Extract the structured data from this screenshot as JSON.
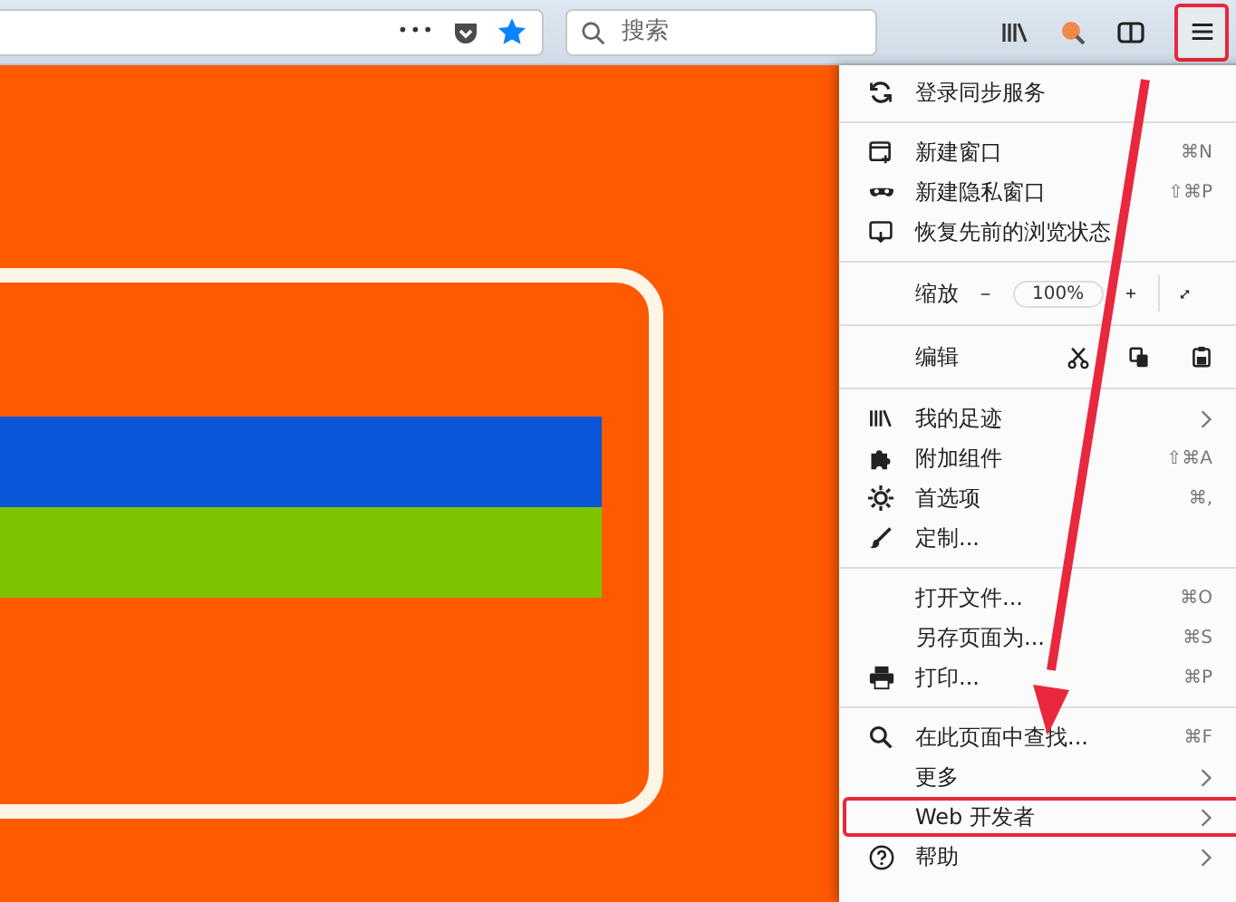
{
  "toolbar": {
    "page_actions": "•••",
    "search": {
      "placeholder": "搜索"
    },
    "menu_button": {
      "highlighted": true
    }
  },
  "menu": {
    "sections": [
      {
        "items": [
          {
            "kind": "item",
            "label": "登录同步服务",
            "submenu": false,
            "highlighted": false
          }
        ]
      },
      {
        "items": [
          {
            "kind": "item",
            "label": "新建窗口",
            "shortcut": "⌘N",
            "submenu": false,
            "highlighted": false
          },
          {
            "kind": "item",
            "label": "新建隐私窗口",
            "shortcut": "⇧⌘P",
            "submenu": false,
            "highlighted": false
          },
          {
            "kind": "item",
            "label": "恢复先前的浏览状态",
            "submenu": false,
            "highlighted": false
          }
        ]
      },
      {
        "items": [
          {
            "kind": "zoom",
            "label": "缩放",
            "value": "100%"
          }
        ]
      },
      {
        "items": [
          {
            "kind": "edit",
            "label": "编辑"
          }
        ]
      },
      {
        "items": [
          {
            "kind": "item",
            "label": "我的足迹",
            "submenu": true,
            "highlighted": false
          },
          {
            "kind": "item",
            "label": "附加组件",
            "shortcut": "⇧⌘A",
            "submenu": false,
            "highlighted": false
          },
          {
            "kind": "item",
            "label": "首选项",
            "shortcut": "⌘,",
            "submenu": false,
            "highlighted": false
          },
          {
            "kind": "item",
            "label": "定制...",
            "submenu": false,
            "highlighted": false
          }
        ]
      },
      {
        "items": [
          {
            "kind": "item",
            "label": "打开文件...",
            "shortcut": "⌘O",
            "submenu": false,
            "highlighted": false
          },
          {
            "kind": "item",
            "label": "另存页面为...",
            "shortcut": "⌘S",
            "submenu": false,
            "highlighted": false
          },
          {
            "kind": "item",
            "label": "打印...",
            "shortcut": "⌘P",
            "submenu": false,
            "highlighted": false
          }
        ]
      },
      {
        "items": [
          {
            "kind": "item",
            "label": "在此页面中查找...",
            "shortcut": "⌘F",
            "submenu": false,
            "highlighted": false
          },
          {
            "kind": "item",
            "label": "更多",
            "submenu": true,
            "highlighted": false
          },
          {
            "kind": "item",
            "label": "Web 开发者",
            "submenu": true,
            "highlighted": true
          },
          {
            "kind": "item",
            "label": "帮助",
            "submenu": true,
            "highlighted": false
          }
        ]
      }
    ]
  }
}
